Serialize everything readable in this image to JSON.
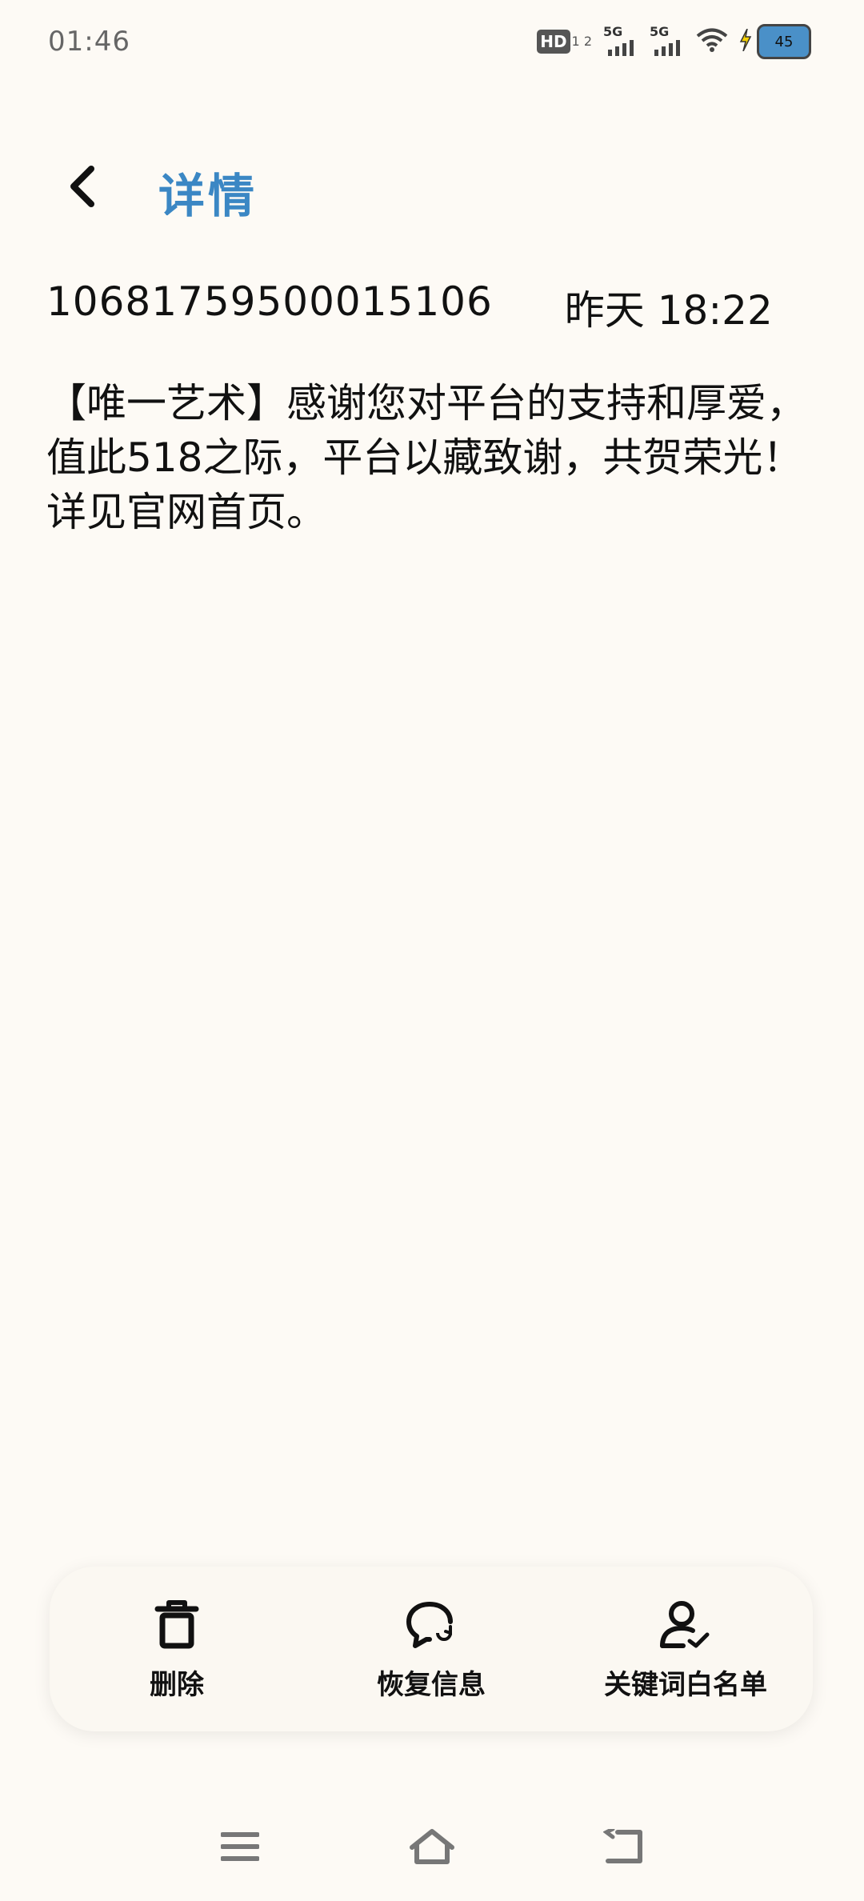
{
  "status_bar": {
    "time": "01:46",
    "network_1": "5G",
    "network_2": "5G",
    "hd_label": "HD",
    "hd_sub": "1 2",
    "battery_level": "45"
  },
  "header": {
    "title": "详情"
  },
  "message": {
    "sender": "10681759500015106",
    "time": "昨天 18:22",
    "body": "【唯一艺术】感谢您对平台的支持和厚爱，值此518之际，平台以藏致谢，共贺荣光！详见官网首页。"
  },
  "actions": [
    {
      "label": "删除",
      "icon": "trash-icon"
    },
    {
      "label": "恢复信息",
      "icon": "restore-message-icon"
    },
    {
      "label": "关键词白名单",
      "icon": "user-check-icon"
    }
  ],
  "navigation": {
    "icons": [
      "menu-icon",
      "home-icon",
      "back-icon"
    ]
  }
}
